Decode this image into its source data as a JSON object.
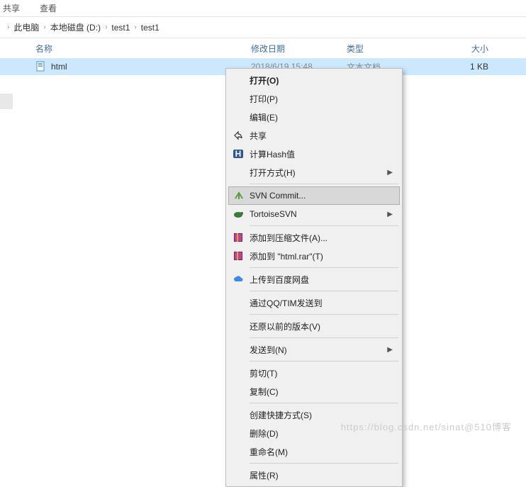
{
  "toolbar": {
    "share": "共享",
    "view": "查看"
  },
  "breadcrumb": {
    "items": [
      "此电脑",
      "本地磁盘 (D:)",
      "test1",
      "test1"
    ]
  },
  "columns": {
    "name": "名称",
    "date": "修改日期",
    "type": "类型",
    "size": "大小"
  },
  "file": {
    "name": "html",
    "date": "2018/6/19 15:48",
    "type": "文本文档",
    "size": "1 KB"
  },
  "menu": {
    "open": "打开(O)",
    "print": "打印(P)",
    "edit": "编辑(E)",
    "shareitem": "共享",
    "hash": "计算Hash值",
    "openwith": "打开方式(H)",
    "svncommit": "SVN Commit...",
    "tortoise": "TortoiseSVN",
    "addarchive": "添加到压缩文件(A)...",
    "addrar": "添加到 \"html.rar\"(T)",
    "baidu": "上传到百度网盘",
    "qqtim": "通过QQ/TIM发送到",
    "restore": "还原以前的版本(V)",
    "sendto": "发送到(N)",
    "cut": "剪切(T)",
    "copy": "复制(C)",
    "shortcut": "创建快捷方式(S)",
    "delete": "删除(D)",
    "rename": "重命名(M)",
    "props": "属性(R)"
  },
  "watermark": "https://blog.csdn.net/sinat@510博客"
}
